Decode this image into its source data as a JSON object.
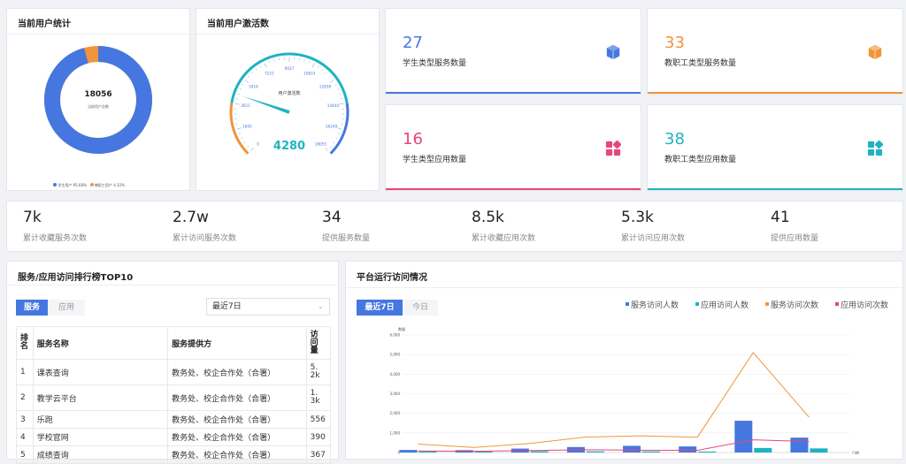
{
  "users_panel": {
    "title": "当前用户统计",
    "total": "18056",
    "total_caption": "当前用户总数",
    "legend": [
      {
        "label": "学生用户",
        "pct": "95.68%",
        "color": "#4677e0"
      },
      {
        "label": "教职工用户",
        "pct": "4.32%",
        "color": "#f0953a"
      }
    ],
    "student_share": 0.9568
  },
  "gauge_panel": {
    "title": "当前用户激活数",
    "caption": "用户激活数",
    "value": "4280",
    "value_num": 4280,
    "max": 18055,
    "ticks": [
      "0",
      "1805",
      "3611",
      "5416",
      "7222",
      "9027",
      "10833",
      "12638",
      "14444",
      "16249",
      "18055"
    ]
  },
  "stat_cards": [
    {
      "value": "27",
      "label": "学生类型服务数量",
      "color": "#4677e0",
      "icon": "cube-icon"
    },
    {
      "value": "33",
      "label": "教职工类型服务数量",
      "color": "#f0953a",
      "icon": "cube-icon"
    },
    {
      "value": "16",
      "label": "学生类型应用数量",
      "color": "#e8457a",
      "icon": "apps-grid-icon"
    },
    {
      "value": "38",
      "label": "教职工类型应用数量",
      "color": "#1fb3c2",
      "icon": "apps-grid-icon"
    }
  ],
  "kpis": [
    {
      "value": "7k",
      "label": "累计收藏服务次数"
    },
    {
      "value": "2.7w",
      "label": "累计访问服务次数"
    },
    {
      "value": "34",
      "label": "提供服务数量"
    },
    {
      "value": "8.5k",
      "label": "累计收藏应用次数"
    },
    {
      "value": "5.3k",
      "label": "累计访问应用次数"
    },
    {
      "value": "41",
      "label": "提供应用数量"
    }
  ],
  "ranking": {
    "title": "服务/应用访问排行榜TOP10",
    "tabs": [
      "服务",
      "应用"
    ],
    "range_select": "最近7日",
    "columns": [
      "排名",
      "服务名称",
      "服务提供方",
      "访问量"
    ],
    "rows": [
      [
        "1",
        "课表查询",
        "教务处、校企合作处（合署）",
        "5.2k"
      ],
      [
        "2",
        "教学云平台",
        "教务处、校企合作处（合署）",
        "1.3k"
      ],
      [
        "3",
        "乐跑",
        "教务处、校企合作处（合署）",
        "556"
      ],
      [
        "4",
        "学校官网",
        "教务处、校企合作处（合署）",
        "390"
      ],
      [
        "5",
        "成绩查询",
        "教务处、校企合作处（合署）",
        "367"
      ]
    ]
  },
  "platform": {
    "title": "平台运行访问情况",
    "tabs": [
      "最近7日",
      "今日"
    ],
    "legend": [
      {
        "label": "服务访问人数",
        "color": "#4677e0"
      },
      {
        "label": "应用访问人数",
        "color": "#1fb3c2"
      },
      {
        "label": "服务访问次数",
        "color": "#f0953a"
      },
      {
        "label": "应用访问次数",
        "color": "#e8457a"
      }
    ]
  },
  "chart_data": {
    "type": "bar",
    "ylabel": "数量",
    "xlabel": "日期",
    "ylim": [
      0,
      6000
    ],
    "y_ticks": [
      "0",
      "1,000",
      "2,000",
      "3,000",
      "4,000",
      "5,000",
      "6,000"
    ],
    "series": [
      {
        "name": "服务访问人数",
        "kind": "bar",
        "values": [
          130,
          120,
          200,
          280,
          340,
          310,
          1620,
          760
        ]
      },
      {
        "name": "应用访问人数",
        "kind": "bar",
        "values": [
          60,
          50,
          70,
          60,
          60,
          50,
          230,
          210
        ]
      },
      {
        "name": "服务访问次数",
        "kind": "line",
        "values": [
          430,
          260,
          460,
          790,
          850,
          780,
          5100,
          1800
        ]
      },
      {
        "name": "应用访问次数",
        "kind": "line",
        "values": [
          80,
          60,
          100,
          140,
          120,
          110,
          650,
          560
        ]
      }
    ]
  }
}
